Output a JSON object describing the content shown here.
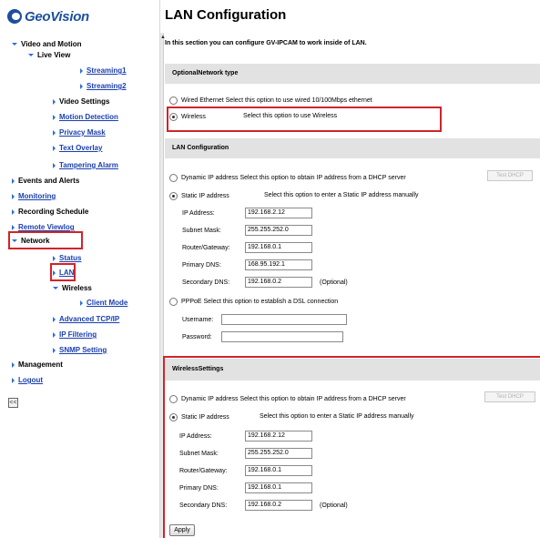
{
  "brand": {
    "name": "GeoVision"
  },
  "nav": {
    "video_motion": "Video and Motion",
    "live_view": "Live View",
    "streaming1": "Streaming1",
    "streaming2": "Streaming2",
    "video_settings": "Video Settings",
    "motion_detection": "Motion Detection",
    "privacy_mask": "Privacy Mask",
    "text_overlay": "Text Overlay",
    "tampering_alarm": "Tampering Alarm",
    "events_alerts": "Events and Alerts",
    "monitoring": "Monitoring",
    "recording_schedule": "Recording Schedule",
    "remote_viewlog": "Remote Viewlog",
    "network": "Network",
    "status": "Status",
    "lan": "LAN",
    "wireless": "Wireless",
    "client_mode": "Client Mode",
    "advanced_tcpip": "Advanced TCP/IP",
    "ip_filtering": "IP Filtering",
    "snmp_setting": "SNMP Setting",
    "management": "Management",
    "logout": "Logout",
    "collapse": "<<"
  },
  "page": {
    "title": "LAN Configuration",
    "intro": "In this section you can configure GV-IPCAM to work inside of LAN."
  },
  "optional_network": {
    "header": "OptionalNetwork type",
    "wired": "Wired Ethernet Select this option to use wired 10/100Mbps ethernet",
    "wireless_label": "Wireless",
    "wireless_desc": "Select this option to use Wireless",
    "selected": "wireless"
  },
  "lan": {
    "header": "LAN Configuration",
    "dynamic": "Dynamic IP address Select this option to obtain IP address from a DHCP server",
    "test_dhcp": "Test DHCP",
    "static_label": "Static IP address",
    "static_desc": "Select this option to enter a Static IP address manually",
    "ip_label": "IP Address:",
    "ip_value": "192.168.2.12",
    "mask_label": "Subnet Mask:",
    "mask_value": "255.255.252.0",
    "gw_label": "Router/Gateway:",
    "gw_value": "192.168.0.1",
    "dns1_label": "Primary DNS:",
    "dns1_value": "168.95.192.1",
    "dns2_label": "Secondary DNS:",
    "dns2_value": "192.168.0.2",
    "optional": "(Optional)",
    "pppoe": "PPPoE  Select this option to establish a DSL connection",
    "username_label": "Username:",
    "username_value": "",
    "password_label": "Password:",
    "password_value": ""
  },
  "wireless_settings": {
    "header": "WirelessSettings",
    "dynamic": "Dynamic IP address Select this option to obtain IP address from a DHCP server",
    "test_dhcp": "Test DHCP",
    "static_label": "Static IP address",
    "static_desc": "Select this option to enter a Static IP address manually",
    "ip_label": "IP Address:",
    "ip_value": "192.168.2.12",
    "mask_label": "Subnet Mask:",
    "mask_value": "255.255.252.0",
    "gw_label": "Router/Gateway:",
    "gw_value": "192.168.0.1",
    "dns1_label": "Primary DNS:",
    "dns1_value": "192.168.0.1",
    "dns2_label": "Secondary DNS:",
    "dns2_value": "192.168.0.2",
    "optional": "(Optional)"
  },
  "apply_label": "Apply",
  "colors": {
    "nav_link": "#1a3fb0",
    "highlight": "#d2232a",
    "section_bg": "#e2e2e2",
    "arrow": "#2b6fd6"
  }
}
